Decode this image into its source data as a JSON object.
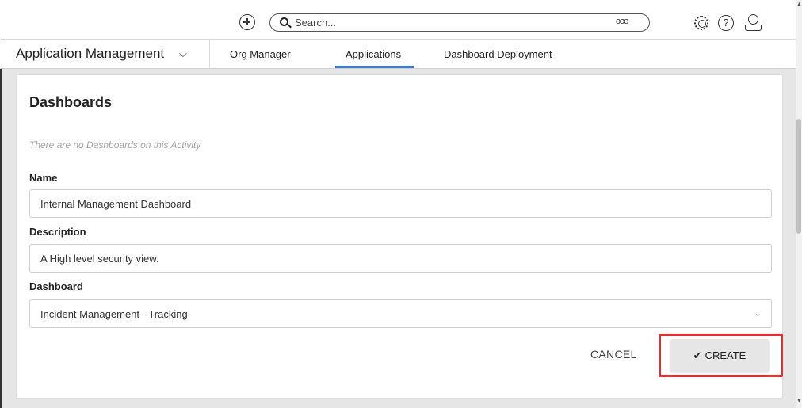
{
  "topbar": {
    "search_placeholder": "Search...",
    "more_glyph": "ooo",
    "help_glyph": "?"
  },
  "nav": {
    "app_title": "Application Management",
    "tabs": [
      {
        "label": "Org Manager",
        "active": false
      },
      {
        "label": "Applications",
        "active": true
      },
      {
        "label": "Dashboard Deployment",
        "active": false
      }
    ]
  },
  "card": {
    "title": "Dashboards",
    "empty_message": "There are no Dashboards on this Activity",
    "fields": {
      "name_label": "Name",
      "name_value": "Internal Management Dashboard",
      "description_label": "Description",
      "description_value": "A High level security view.",
      "dashboard_label": "Dashboard",
      "dashboard_value": "Incident Management - Tracking"
    },
    "actions": {
      "cancel": "CANCEL",
      "create": "CREATE"
    }
  },
  "colors": {
    "active_tab": "#3a7bd5",
    "highlight": "#e03030"
  }
}
